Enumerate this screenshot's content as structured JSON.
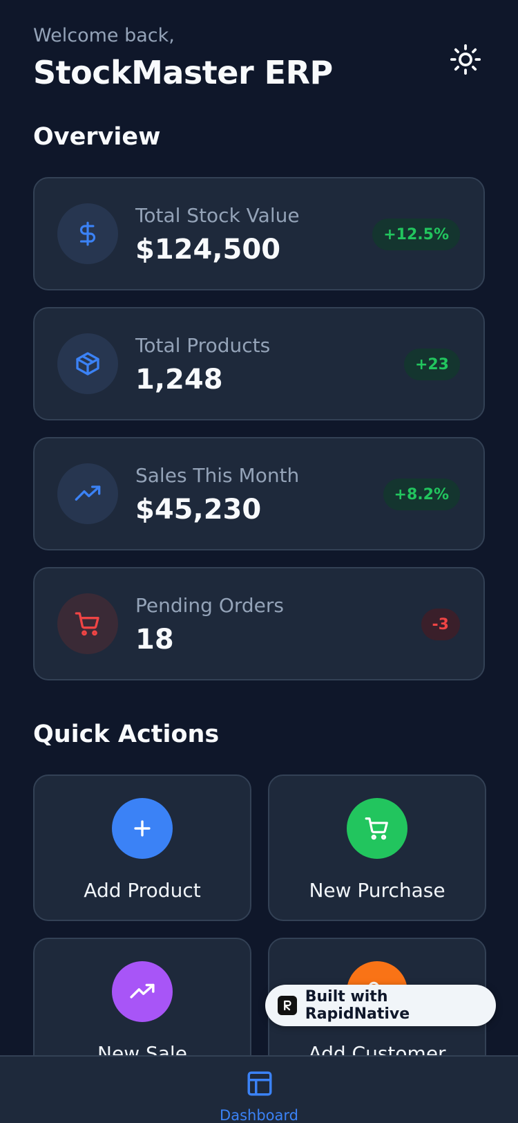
{
  "header": {
    "welcome": "Welcome back,",
    "title": "StockMaster ERP",
    "theme_icon": "sun-icon"
  },
  "overview": {
    "title": "Overview",
    "cards": [
      {
        "label": "Total Stock Value",
        "value": "$124,500",
        "badge": "+12.5%",
        "icon": "dollar-icon",
        "trend": "up"
      },
      {
        "label": "Total Products",
        "value": "1,248",
        "badge": "+23",
        "icon": "package-icon",
        "trend": "up"
      },
      {
        "label": "Sales This Month",
        "value": "$45,230",
        "badge": "+8.2%",
        "icon": "trending-up-icon",
        "trend": "up"
      },
      {
        "label": "Pending Orders",
        "value": "18",
        "badge": "-3",
        "icon": "cart-icon",
        "trend": "down"
      }
    ]
  },
  "quick_actions": {
    "title": "Quick Actions",
    "items": [
      {
        "label": "Add Product",
        "icon": "plus-icon",
        "color": "#3b82f6"
      },
      {
        "label": "New Purchase",
        "icon": "cart-icon",
        "color": "#22c55e"
      },
      {
        "label": "New Sale",
        "icon": "trending-up-icon",
        "color": "#a855f7"
      },
      {
        "label": "Add Customer",
        "icon": "user-plus-icon",
        "color": "#f97316"
      }
    ]
  },
  "tabbar": {
    "dashboard_label": "Dashboard",
    "dashboard_icon": "layout-icon"
  },
  "badge": {
    "text": "Built with RapidNative"
  },
  "colors": {
    "background": "#0f172a",
    "card": "#1e293b",
    "border": "#334155",
    "accent": "#3b82f6",
    "positive": "#22c55e",
    "negative": "#ef4444"
  }
}
